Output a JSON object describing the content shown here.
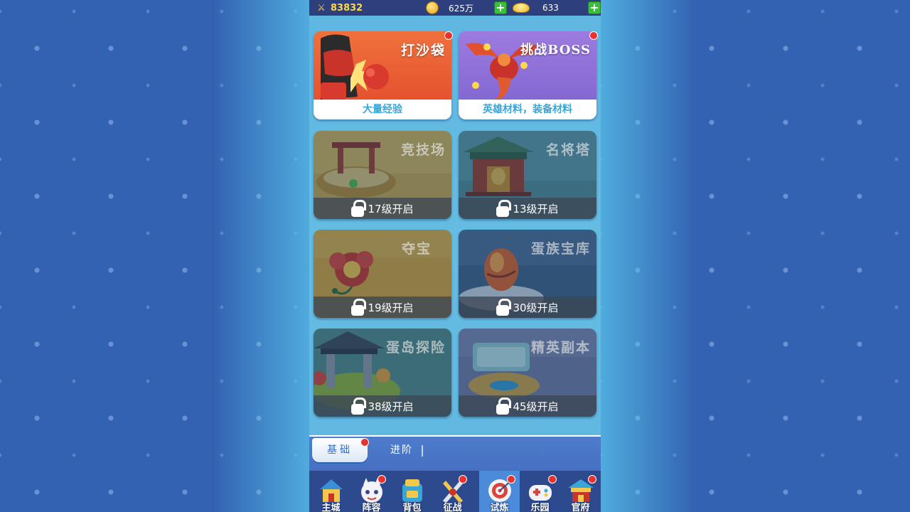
{
  "topbar": {
    "power_value": "83832",
    "coins_value": "625万",
    "gold_value": "633"
  },
  "cards": [
    {
      "title": "打沙袋",
      "subtitle": "大量经验",
      "locked": false,
      "color": "#e85b2f"
    },
    {
      "title": "挑战BOSS",
      "subtitle": "英雄材料，装备材料",
      "locked": false,
      "color": "#8c72d8"
    },
    {
      "title": "竞技场",
      "unlock_text": "17级开启",
      "locked": true
    },
    {
      "title": "名将塔",
      "unlock_text": "13级开启",
      "locked": true
    },
    {
      "title": "夺宝",
      "unlock_text": "19级开启",
      "locked": true
    },
    {
      "title": "蛋族宝库",
      "unlock_text": "30级开启",
      "locked": true
    },
    {
      "title": "蛋岛探险",
      "unlock_text": "38级开启",
      "locked": true
    },
    {
      "title": "精英副本",
      "unlock_text": "45级开启",
      "locked": true
    }
  ],
  "tabs": {
    "basic": "基础",
    "advanced": "进阶"
  },
  "nav": [
    {
      "label": "主城",
      "icon": "main-city-icon"
    },
    {
      "label": "阵容",
      "icon": "lineup-icon"
    },
    {
      "label": "背包",
      "icon": "backpack-icon"
    },
    {
      "label": "征战",
      "icon": "campaign-icon"
    },
    {
      "label": "试炼",
      "icon": "trial-icon",
      "active": true
    },
    {
      "label": "乐园",
      "icon": "paradise-icon"
    },
    {
      "label": "官府",
      "icon": "government-icon"
    }
  ],
  "colors": {
    "accent": "#3aa6d8",
    "badge": "#e8322d",
    "nav_active": "#4c8bd9"
  }
}
